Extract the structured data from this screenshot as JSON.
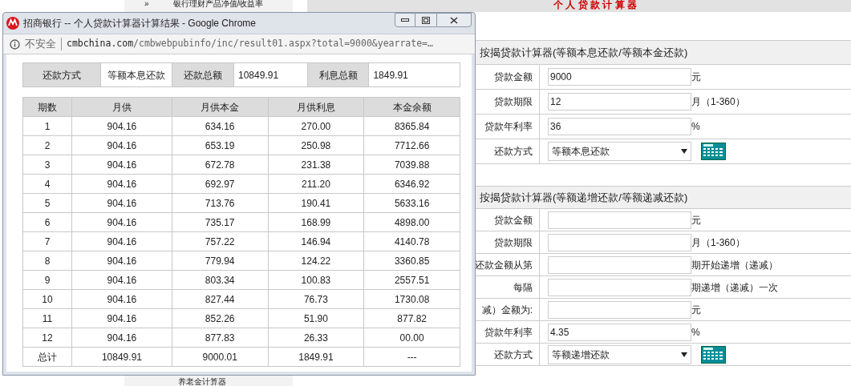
{
  "page": {
    "heading": "个 人 贷 款 计 算 器",
    "sidebar_items": [
      {
        "bullet": "»",
        "label": "银行理财产品净值/收益率"
      },
      {
        "label": "养老金计算器"
      }
    ]
  },
  "form_sections": [
    {
      "title": "按揭贷款计算器(等额本息还款/等额本金还款)",
      "rows": [
        {
          "kind": "input",
          "label": "贷款金额",
          "value": "9000",
          "unit": "元"
        },
        {
          "kind": "input",
          "label": "贷款期限",
          "value": "12",
          "unit": "月（1-360）"
        },
        {
          "kind": "input",
          "label": "贷款年利率",
          "value": "36",
          "unit": "%"
        },
        {
          "kind": "select",
          "label": "还款方式",
          "value": "等额本息还款"
        }
      ]
    },
    {
      "title": "按揭贷款计算器(等额递增还款/等额递减还款)",
      "rows": [
        {
          "kind": "input",
          "label": "贷款金额",
          "unit": "元"
        },
        {
          "kind": "input",
          "label": "贷款期限",
          "unit": "月（1-360）"
        },
        {
          "kind": "input",
          "label": "还款金额从第",
          "unit": "期开始递增（递减）"
        },
        {
          "kind": "input",
          "label": "每隔",
          "unit": "期递增（递减）一次"
        },
        {
          "kind": "input",
          "label": "减）金额为:",
          "unit": "元"
        },
        {
          "kind": "input",
          "label": "贷款年利率",
          "value": "4.35",
          "unit": "%"
        },
        {
          "kind": "select",
          "label": "还款方式",
          "value": "等额递增还款"
        }
      ]
    }
  ],
  "popup": {
    "title": "招商银行 -- 个人贷款计算器计算结果 - Google Chrome",
    "security": "不安全",
    "url_host": "cmbchina.com",
    "url_path": "/cmbwebpubinfo/inc/result01.aspx?total=9000&yearrate=…",
    "summary": [
      {
        "label": "还款方式",
        "value": "等额本息还款"
      },
      {
        "label": "还款总额",
        "value": "10849.91"
      },
      {
        "label": "利息总额",
        "value": "1849.91"
      }
    ],
    "table": {
      "columns": [
        "期数",
        "月供",
        "月供本金",
        "月供利息",
        "本金余额"
      ],
      "rows": [
        [
          "1",
          "904.16",
          "634.16",
          "270.00",
          "8365.84"
        ],
        [
          "2",
          "904.16",
          "653.19",
          "250.98",
          "7712.66"
        ],
        [
          "3",
          "904.16",
          "672.78",
          "231.38",
          "7039.88"
        ],
        [
          "4",
          "904.16",
          "692.97",
          "211.20",
          "6346.92"
        ],
        [
          "5",
          "904.16",
          "713.76",
          "190.41",
          "5633.16"
        ],
        [
          "6",
          "904.16",
          "735.17",
          "168.99",
          "4898.00"
        ],
        [
          "7",
          "904.16",
          "757.22",
          "146.94",
          "4140.78"
        ],
        [
          "8",
          "904.16",
          "779.94",
          "124.22",
          "3360.85"
        ],
        [
          "9",
          "904.16",
          "803.34",
          "100.83",
          "2557.51"
        ],
        [
          "10",
          "904.16",
          "827.44",
          "76.73",
          "1730.08"
        ],
        [
          "11",
          "904.16",
          "852.26",
          "51.90",
          "877.82"
        ],
        [
          "12",
          "904.16",
          "877.83",
          "26.33",
          "00.00"
        ],
        [
          "总计",
          "10849.91",
          "9000.01",
          "1849.91",
          "---"
        ]
      ]
    }
  }
}
